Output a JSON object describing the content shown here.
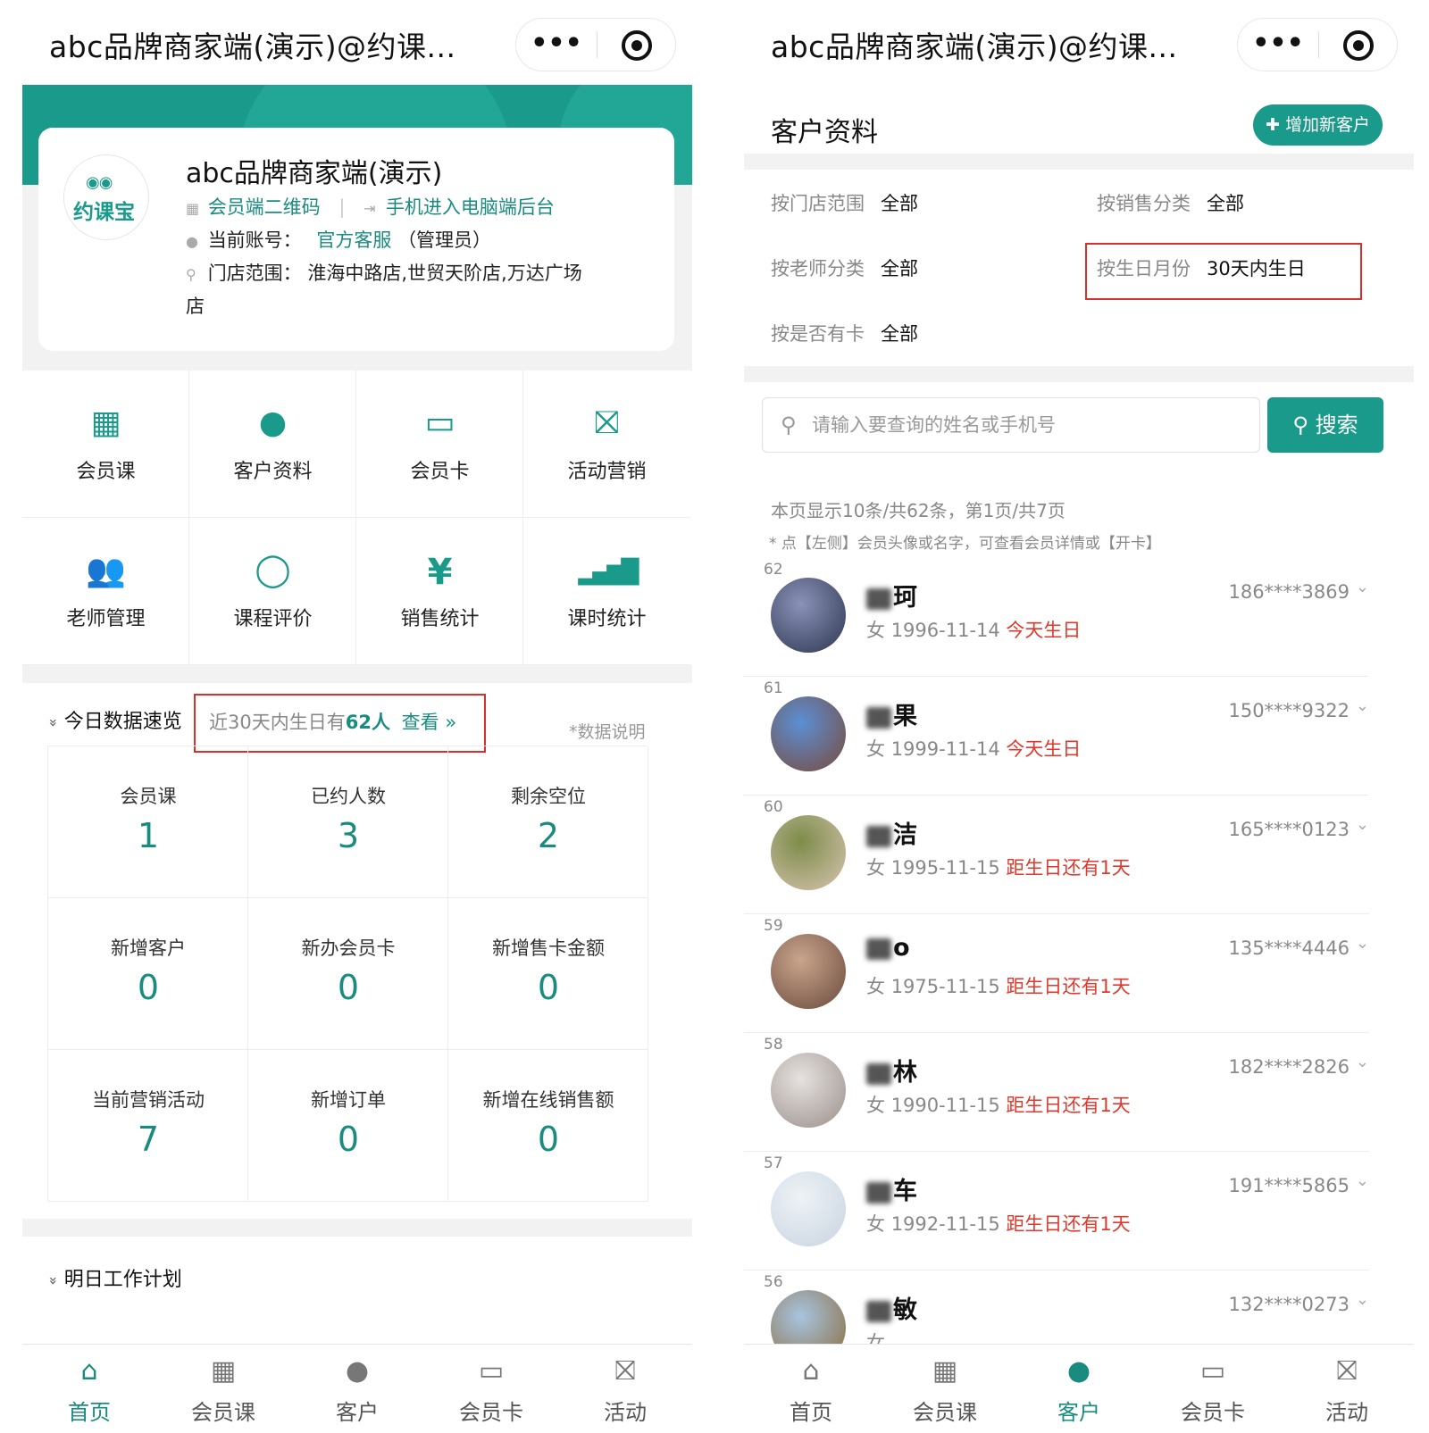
{
  "window": {
    "title": "abc品牌商家端(演示)@约课...",
    "more_glyph": "•••"
  },
  "profile": {
    "logo_text": "约课宝",
    "logo_eyes": "◉◉",
    "name": "abc品牌商家端(演示)",
    "qr_link": "会员端二维码",
    "divider": "|",
    "pc_link": "手机进入电脑端后台",
    "account_label": "当前账号：",
    "account_name": "官方客服",
    "account_role": "（管理员）",
    "store_label": "门店范围：",
    "store_value": "淮海中路店,世贸天阶店,万达广场",
    "store_value_2": "店"
  },
  "menu": [
    {
      "label": "会员课",
      "icon": "calendar-grid-icon",
      "glyph": "▦"
    },
    {
      "label": "客户资料",
      "icon": "person-icon",
      "glyph": "●"
    },
    {
      "label": "会员卡",
      "icon": "card-icon",
      "glyph": "▭"
    },
    {
      "label": "活动营销",
      "icon": "gift-icon",
      "glyph": "⛝"
    },
    {
      "label": "老师管理",
      "icon": "group-icon",
      "glyph": "👥"
    },
    {
      "label": "课程评价",
      "icon": "chat-bubble-icon",
      "glyph": "◯"
    },
    {
      "label": "销售统计",
      "icon": "yen-icon",
      "glyph": "¥"
    },
    {
      "label": "课时统计",
      "icon": "signal-bars-icon",
      "glyph": "▂▄▆█"
    }
  ],
  "today": {
    "heading": "今日数据速览",
    "bday_prefix": "近30天内生日有",
    "bday_count": "62人",
    "bday_link": "查看 »",
    "data_note": "*数据说明",
    "stats": [
      {
        "label": "会员课",
        "value": "1"
      },
      {
        "label": "已约人数",
        "value": "3"
      },
      {
        "label": "剩余空位",
        "value": "2"
      },
      {
        "label": "新增客户",
        "value": "0"
      },
      {
        "label": "新办会员卡",
        "value": "0"
      },
      {
        "label": "新增售卡金额",
        "value": "0"
      },
      {
        "label": "当前营销活动",
        "value": "7"
      },
      {
        "label": "新增订单",
        "value": "0"
      },
      {
        "label": "新增在线销售额",
        "value": "0"
      }
    ]
  },
  "plan": {
    "heading": "明日工作计划"
  },
  "collapse_glyph": "»",
  "tabs": [
    {
      "label": "首页",
      "icon": "home-icon",
      "glyph": "⌂"
    },
    {
      "label": "会员课",
      "icon": "calendar-grid-icon",
      "glyph": "▦"
    },
    {
      "label": "客户",
      "icon": "person-icon",
      "glyph": "●"
    },
    {
      "label": "会员卡",
      "icon": "card-icon",
      "glyph": "▭"
    },
    {
      "label": "活动",
      "icon": "gift-icon",
      "glyph": "⛝"
    }
  ],
  "customers": {
    "title": "客户资料",
    "add_button": "✚ 增加新客户",
    "filters": [
      {
        "key": "按门店范围",
        "value": "全部"
      },
      {
        "key": "按销售分类",
        "value": "全部"
      },
      {
        "key": "按老师分类",
        "value": "全部"
      },
      {
        "key": "按生日月份",
        "value": "30天内生日"
      },
      {
        "key": "按是否有卡",
        "value": "全部"
      }
    ],
    "search_placeholder": "请输入要查询的姓名或手机号",
    "search_button": "搜索",
    "page_info": "本页显示10条/共62条，第1页/共7页",
    "hint": "* 点【左侧】会员头像或名字，可查看会员详情或【开卡】",
    "rows": [
      {
        "idx": "62",
        "name": "珂",
        "gender": "女",
        "birthday": "1996-11-14",
        "status": "今天生日",
        "phone": "186****3869",
        "avatar": [
          "#8a93b8",
          "#2d3550"
        ]
      },
      {
        "idx": "61",
        "name": "果",
        "gender": "女",
        "birthday": "1999-11-14",
        "status": "今天生日",
        "phone": "150****9322",
        "avatar": [
          "#5b8fd4",
          "#7a4a3a"
        ]
      },
      {
        "idx": "60",
        "name": "洁",
        "gender": "女",
        "birthday": "1995-11-15",
        "status": "距生日还有1天",
        "phone": "165****0123",
        "avatar": [
          "#7c8c4a",
          "#d8c4b0"
        ]
      },
      {
        "idx": "59",
        "name": "o",
        "gender": "女",
        "birthday": "1975-11-15",
        "status": "距生日还有1天",
        "phone": "135****4446",
        "avatar": [
          "#c9a58c",
          "#6a4a3c"
        ]
      },
      {
        "idx": "58",
        "name": "林",
        "gender": "女",
        "birthday": "1990-11-15",
        "status": "距生日还有1天",
        "phone": "182****2826",
        "avatar": [
          "#e6e2e0",
          "#9a8f8a"
        ]
      },
      {
        "idx": "57",
        "name": "车",
        "gender": "女",
        "birthday": "1992-11-15",
        "status": "距生日还有1天",
        "phone": "191****5865",
        "avatar": [
          "#eef2f6",
          "#c8d4e0"
        ]
      },
      {
        "idx": "56",
        "name": "敏",
        "gender": "女",
        "birthday": "",
        "status": "",
        "phone": "132****0273",
        "avatar": [
          "#a8c4e0",
          "#8a6a3a"
        ]
      }
    ]
  },
  "colors": {
    "accent": "#1a9a8a",
    "highlight_red": "#d9302b"
  }
}
